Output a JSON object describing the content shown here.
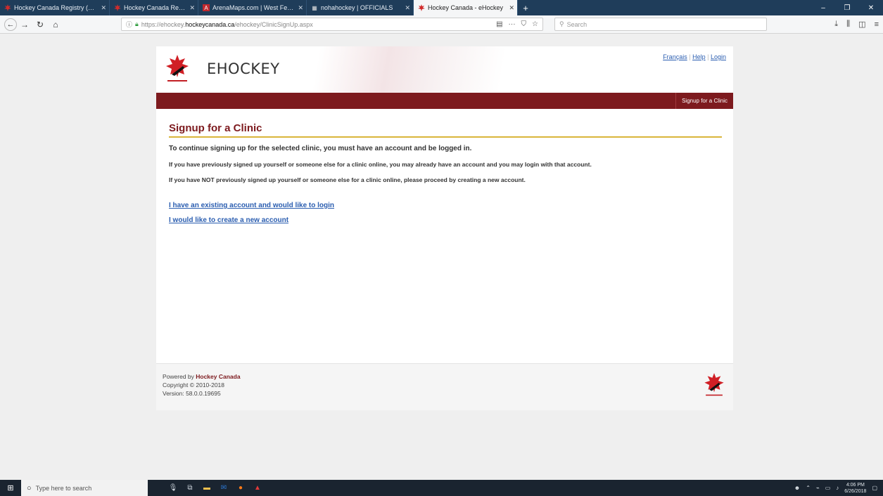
{
  "browser": {
    "tabs": [
      {
        "title": "Hockey Canada Registry (HCR)",
        "active": false
      },
      {
        "title": "Hockey Canada Registry (HCR)",
        "active": false
      },
      {
        "title": "ArenaMaps.com | West Ferris C",
        "active": false
      },
      {
        "title": "nohahockey | OFFICIALS",
        "active": false
      },
      {
        "title": "Hockey Canada - eHockey",
        "active": true
      }
    ],
    "new_tab": "+",
    "url_prefix": "https://ehockey.",
    "url_host": "hockeycanada.ca",
    "url_path": "/ehockey/ClinicSignUp.aspx",
    "search_placeholder": "Search",
    "url_tools_label": "···",
    "window_min": "–",
    "window_max": "❐",
    "window_close": "✕"
  },
  "site": {
    "brand": "EHOCKEY",
    "links": {
      "french": "Français",
      "help": "Help",
      "login": "Login",
      "sep": "|"
    },
    "nav_item": "Signup for a Clinic",
    "heading": "Signup for a Clinic",
    "intro": "To continue signing up for the selected clinic, you must have an account and be logged in.",
    "para_previous": "If you have previously signed up yourself or someone else for a clinic online, you may already have an account and you may login with that account.",
    "para_not_previous": "If you have NOT previously signed up yourself or someone else for a clinic online, please proceed by creating a new account.",
    "link_existing": "I have an existing account and would like to login",
    "link_new": "I would like to create a new account",
    "footer": {
      "powered_prefix": "Powered by ",
      "powered_name": "Hockey Canada",
      "copyright": "Copyright © 2010-2018",
      "version": "Version: 58.0.0.19695"
    }
  },
  "taskbar": {
    "search_placeholder": "Type here to search",
    "time": "4:06 PM",
    "date": "6/26/2018"
  }
}
